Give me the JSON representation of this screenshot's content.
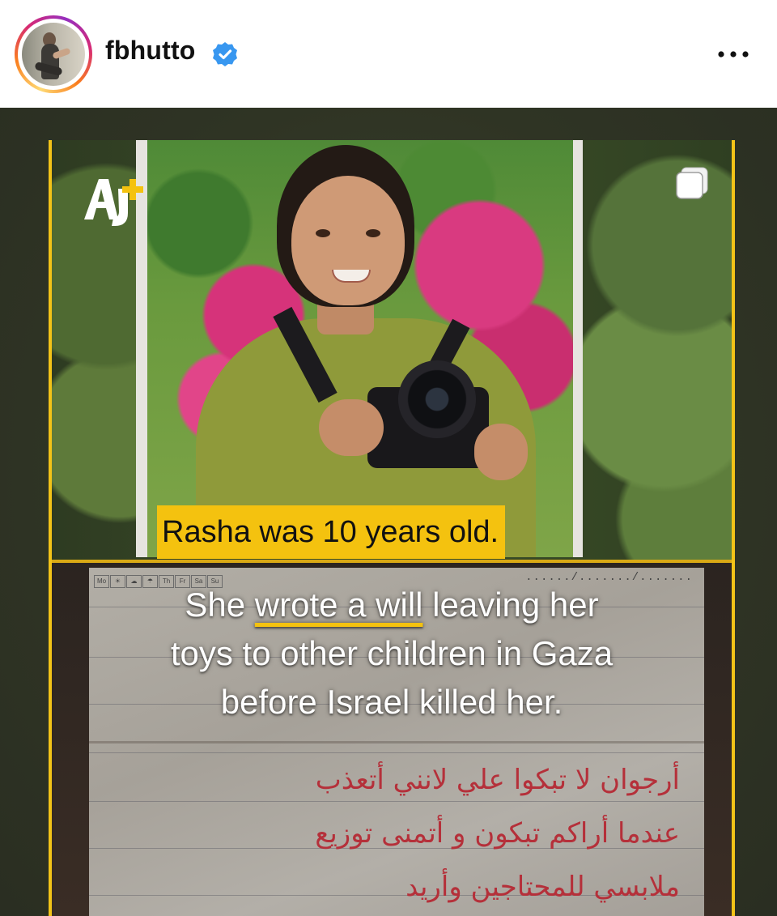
{
  "header": {
    "username": "fbhutto",
    "verified": true,
    "avatar_icon": "profile-avatar",
    "more_icon": "more-horizontal-icon"
  },
  "post": {
    "brand_logo": "AJ+",
    "multi_image_icon": "carousel-icon",
    "caption_title": "Rasha was 10 years old.",
    "overlay_lines": [
      "She ",
      "wrote a will",
      " leaving her",
      "toys to other children in Gaza",
      "before Israel killed her."
    ],
    "letter": {
      "calendar_days": [
        "Mo",
        "Th",
        "Fr",
        "Sa",
        "Su"
      ],
      "date_placeholder": "....../......./.......",
      "arabic_lines": [
        "أرجوان لا تبكوا علي لانني أتعذب",
        "عندما أراكم تبكون و أتمنى توزيع",
        "ملابسي للمحتاجين وأريد"
      ]
    },
    "colors": {
      "accent_yellow": "#f4c20f",
      "verified_blue": "#3897f0",
      "handwriting_red": "#b5303a"
    }
  }
}
